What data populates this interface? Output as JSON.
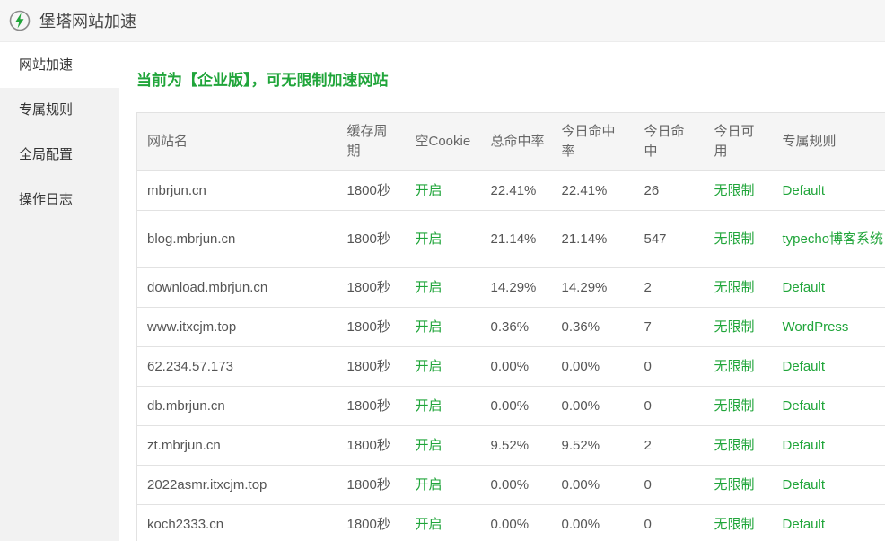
{
  "app": {
    "title": "堡塔网站加速",
    "logo_icon": "lightning-bolt-icon",
    "accent": "#20a53a"
  },
  "sidebar": {
    "items": [
      {
        "label": "网站加速",
        "active": true
      },
      {
        "label": "专属规则",
        "active": false
      },
      {
        "label": "全局配置",
        "active": false
      },
      {
        "label": "操作日志",
        "active": false
      }
    ]
  },
  "banner": "当前为【企业版】，可无限制加速网站",
  "table": {
    "headers": [
      "网站名",
      "缓存周期",
      "空Cookie",
      "总命中率",
      "今日命中率",
      "今日命中",
      "今日可用",
      "专属规则"
    ],
    "rows": [
      {
        "site": "mbrjun.cn",
        "cache": "1800秒",
        "cookie": "开启",
        "total_rate": "22.41%",
        "today_rate": "22.41%",
        "today_hits": "26",
        "available": "无限制",
        "rule": "Default"
      },
      {
        "site": "blog.mbrjun.cn",
        "cache": "1800秒",
        "cookie": "开启",
        "total_rate": "21.14%",
        "today_rate": "21.14%",
        "today_hits": "547",
        "available": "无限制",
        "rule": "typecho博客系统"
      },
      {
        "site": "download.mbrjun.cn",
        "cache": "1800秒",
        "cookie": "开启",
        "total_rate": "14.29%",
        "today_rate": "14.29%",
        "today_hits": "2",
        "available": "无限制",
        "rule": "Default"
      },
      {
        "site": "www.itxcjm.top",
        "cache": "1800秒",
        "cookie": "开启",
        "total_rate": "0.36%",
        "today_rate": "0.36%",
        "today_hits": "7",
        "available": "无限制",
        "rule": "WordPress"
      },
      {
        "site": "62.234.57.173",
        "cache": "1800秒",
        "cookie": "开启",
        "total_rate": "0.00%",
        "today_rate": "0.00%",
        "today_hits": "0",
        "available": "无限制",
        "rule": "Default"
      },
      {
        "site": "db.mbrjun.cn",
        "cache": "1800秒",
        "cookie": "开启",
        "total_rate": "0.00%",
        "today_rate": "0.00%",
        "today_hits": "0",
        "available": "无限制",
        "rule": "Default"
      },
      {
        "site": "zt.mbrjun.cn",
        "cache": "1800秒",
        "cookie": "开启",
        "total_rate": "9.52%",
        "today_rate": "9.52%",
        "today_hits": "2",
        "available": "无限制",
        "rule": "Default"
      },
      {
        "site": "2022asmr.itxcjm.top",
        "cache": "1800秒",
        "cookie": "开启",
        "total_rate": "0.00%",
        "today_rate": "0.00%",
        "today_hits": "0",
        "available": "无限制",
        "rule": "Default"
      },
      {
        "site": "koch2333.cn",
        "cache": "1800秒",
        "cookie": "开启",
        "total_rate": "0.00%",
        "today_rate": "0.00%",
        "today_hits": "0",
        "available": "无限制",
        "rule": "Default"
      }
    ]
  }
}
